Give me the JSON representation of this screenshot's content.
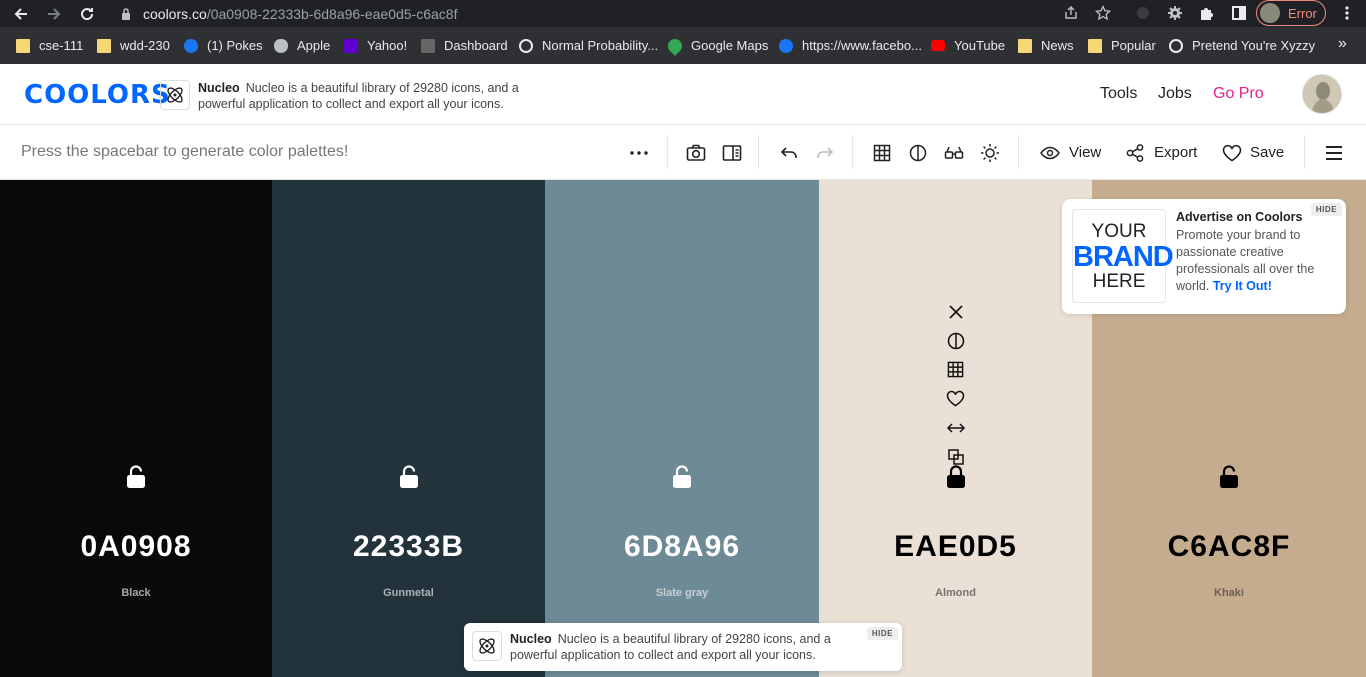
{
  "browser": {
    "url_host": "coolors.co",
    "url_path": "/0a0908-22333b-6d8a96-eae0d5-c6ac8f",
    "profile_label": "Error",
    "bookmarks": [
      {
        "label": "cse-111",
        "icon": "folder"
      },
      {
        "label": "wdd-230",
        "icon": "folder"
      },
      {
        "label": "(1) Pokes",
        "icon": "facebook"
      },
      {
        "label": "Apple",
        "icon": "apple"
      },
      {
        "label": "Yahoo!",
        "icon": "yahoo"
      },
      {
        "label": "Dashboard",
        "icon": "byu"
      },
      {
        "label": "Normal Probability...",
        "icon": "globe"
      },
      {
        "label": "Google Maps",
        "icon": "maps"
      },
      {
        "label": "https://www.facebo...",
        "icon": "facebook"
      },
      {
        "label": "YouTube",
        "icon": "youtube"
      },
      {
        "label": "News",
        "icon": "folder"
      },
      {
        "label": "Popular",
        "icon": "folder"
      },
      {
        "label": "Pretend You're Xyzzy",
        "icon": "globe"
      }
    ],
    "more_label": "»"
  },
  "header": {
    "logo": "COOLORS",
    "ad_brand": "Nucleo",
    "ad_text": "Nucleo is a beautiful library of 29280 icons, and a powerful application to collect and export all your icons.",
    "nav": [
      "Tools",
      "Jobs",
      "Go Pro"
    ],
    "accent": "#e91e8c"
  },
  "toolbar": {
    "hint": "Press the spacebar to generate color palettes!",
    "view_label": "View",
    "export_label": "Export",
    "save_label": "Save"
  },
  "palette": [
    {
      "hex": "0A0908",
      "name": "Black",
      "color": "#0a0908",
      "text": "#ffffff",
      "sub": "#a8a8a8"
    },
    {
      "hex": "22333B",
      "name": "Gunmetal",
      "color": "#22333b",
      "text": "#ffffff",
      "sub": "#aab2b6"
    },
    {
      "hex": "6D8A96",
      "name": "Slate gray",
      "color": "#6d8a96",
      "text": "#ffffff",
      "sub": "#c6d1d6"
    },
    {
      "hex": "EAE0D5",
      "name": "Almond",
      "color": "#eae0d5",
      "text": "#000000",
      "sub": "#777370"
    },
    {
      "hex": "C6AC8F",
      "name": "Khaki",
      "color": "#c6ac8f",
      "text": "#000000",
      "sub": "#6d5f4f"
    }
  ],
  "side_ad": {
    "img_line1": "YOUR",
    "img_line2": "BRAND",
    "img_line3": "HERE",
    "title": "Advertise on Coolors",
    "desc": "Promote your brand to passionate creative professionals all over the world.",
    "cta": "Try It Out!",
    "hide_label": "HIDE"
  },
  "bottom_ad": {
    "brand": "Nucleo",
    "text": "Nucleo is a beautiful library of 29280 icons, and a powerful application to collect and export all your icons.",
    "hide_label": "HIDE"
  }
}
